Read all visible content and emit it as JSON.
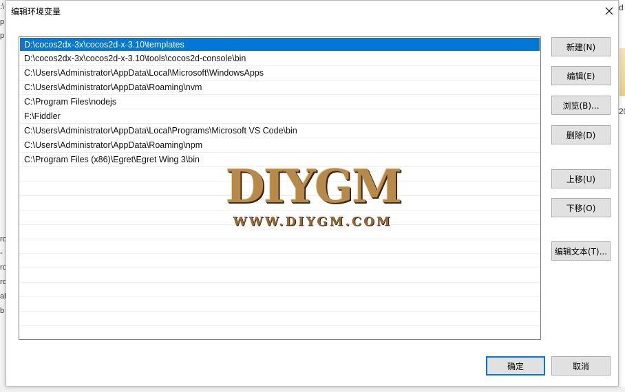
{
  "dialog": {
    "title": "编辑环境变量",
    "close_icon": "close-icon"
  },
  "paths": [
    "D:\\cocos2dx-3x\\cocos2d-x-3.10\\templates",
    "D:\\cocos2dx-3x\\cocos2d-x-3.10\\tools\\cocos2d-console\\bin",
    "C:\\Users\\Administrator\\AppData\\Local\\Microsoft\\WindowsApps",
    "C:\\Users\\Administrator\\AppData\\Roaming\\nvm",
    "C:\\Program Files\\nodejs",
    "F:\\Fiddler",
    "C:\\Users\\Administrator\\AppData\\Local\\Programs\\Microsoft VS Code\\bin",
    "C:\\Users\\Administrator\\AppData\\Roaming\\npm",
    "C:\\Program Files (x86)\\Egret\\Egret Wing 3\\bin"
  ],
  "selected_index": 0,
  "buttons": {
    "new": "新建(N)",
    "edit": "编辑(E)",
    "browse": "浏览(B)...",
    "delete": "删除(D)",
    "move_up": "上移(U)",
    "move_down": "下移(O)",
    "edit_text": "编辑文本(T)...",
    "ok": "确定",
    "cancel": "取消"
  },
  "watermark": {
    "brand": "DIYGM",
    "url": "WWW.DIYGM.COM"
  },
  "background": {
    "left_fragments": [
      ":\\",
      "p",
      "p",
      "ro",
      "-",
      "ro",
      "ro",
      "ab",
      "b"
    ],
    "right_fragments": [
      "d",
      "20"
    ]
  },
  "colors": {
    "selection": "#0078d7",
    "button_face": "#e1e1e1",
    "button_border": "#adadad"
  }
}
